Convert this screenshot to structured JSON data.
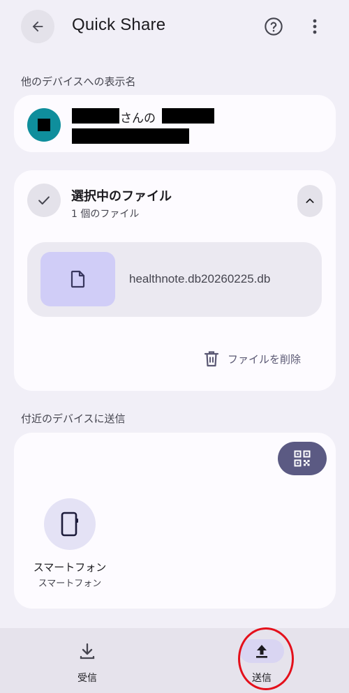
{
  "header": {
    "title": "Quick Share",
    "back_icon": "arrow-back-icon",
    "help_icon": "help-circle-icon",
    "more_icon": "more-vert-icon"
  },
  "display_name_section": {
    "label": "他のデバイスへの表示名",
    "name_suffix": "さんの"
  },
  "selected_files": {
    "title": "選択中のファイル",
    "count_text": "1 個のファイル",
    "file_name": "healthnote.db20260225.db",
    "delete_label": "ファイルを削除"
  },
  "nearby_section": {
    "label": "付近のデバイスに送信",
    "devices": [
      {
        "name": "スマートフォン",
        "type": "スマートフォン"
      }
    ]
  },
  "bottom_nav": {
    "items": [
      {
        "label": "受信",
        "icon": "download-icon"
      },
      {
        "label": "送信",
        "icon": "upload-icon",
        "active": true
      }
    ]
  },
  "colors": {
    "background": "#f1eff7",
    "card": "#fdfbff",
    "avatar": "#0f8e9c",
    "accent": "#5b5a83",
    "highlight": "#e4101b"
  }
}
